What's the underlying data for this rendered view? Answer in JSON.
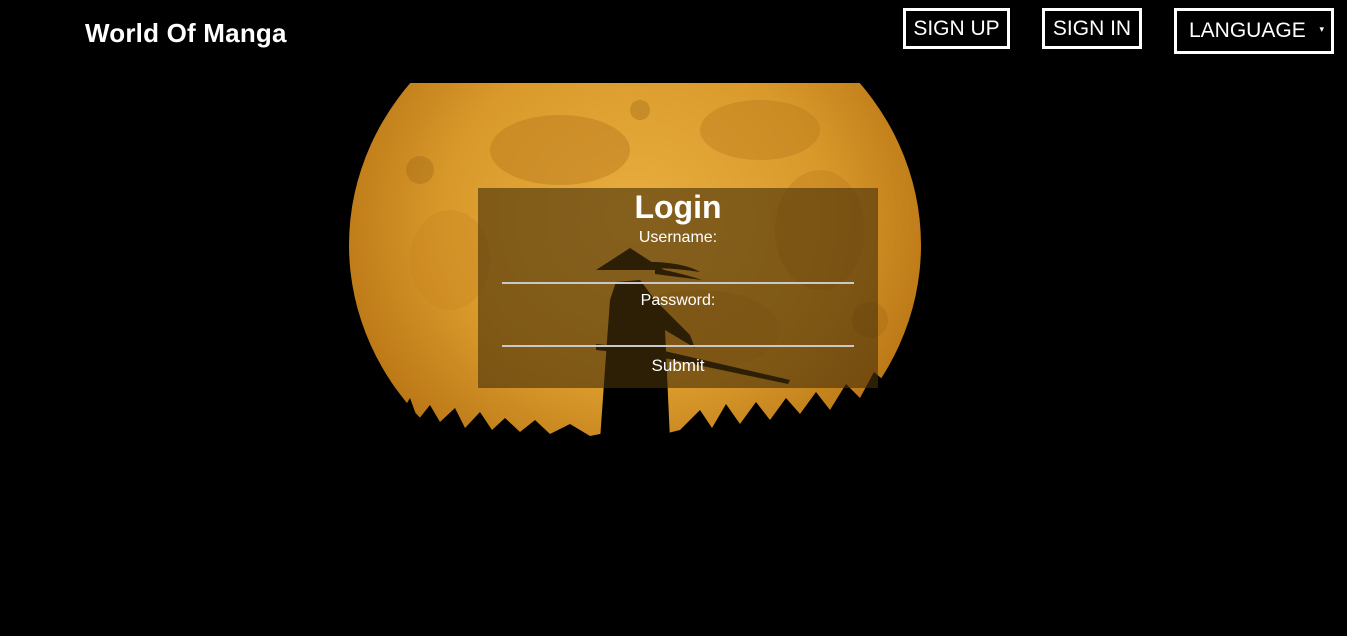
{
  "header": {
    "brand": "World Of Manga",
    "signup_label": "SIGN UP",
    "signin_label": "SIGN IN",
    "language_label": "LANGUAGE",
    "language_caret": "▾"
  },
  "login": {
    "title": "Login",
    "username_label": "Username:",
    "username_value": "",
    "password_label": "Password:",
    "password_value": "",
    "submit_label": "Submit"
  },
  "hero": {
    "image_subject": "samurai silhouette in front of full moon",
    "moon_color": "#d99a2b",
    "moon_shadow_color": "#a86b18"
  }
}
